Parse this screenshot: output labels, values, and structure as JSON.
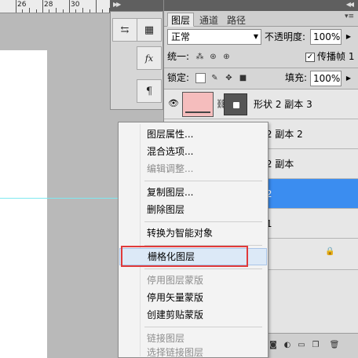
{
  "ruler": {
    "labels": [
      "26",
      "28",
      "30"
    ]
  },
  "panel_tabs": [
    "图层",
    "通道",
    "路径"
  ],
  "blend_mode": "正常",
  "opacity_label": "不透明度:",
  "opacity_value": "100%",
  "unify_label": "统一:",
  "propagate_label": "传播帧 1",
  "propagate_checked": "✓",
  "lock_label": "锁定:",
  "fill_label": "填充:",
  "fill_value": "100%",
  "layers": [
    {
      "name": "形状 2 副本 3",
      "visible": true,
      "selected": false
    },
    {
      "name": "状 2 副本 2",
      "visible": false,
      "selected": false
    },
    {
      "name": "状 2 副本",
      "visible": false,
      "selected": false
    },
    {
      "name": "状 2",
      "visible": false,
      "selected": true
    },
    {
      "name": "状 1",
      "visible": false,
      "selected": false
    }
  ],
  "context_menu": {
    "items": [
      {
        "label": "图层属性...",
        "disabled": false
      },
      {
        "label": "混合选项...",
        "disabled": false
      },
      {
        "label": "编辑调整...",
        "disabled": true
      },
      {
        "label": "复制图层...",
        "disabled": false
      },
      {
        "label": "删除图层",
        "disabled": false
      },
      {
        "label": "转换为智能对象",
        "disabled": false
      },
      {
        "label": "栅格化图层",
        "disabled": false
      },
      {
        "label": "停用图层蒙版",
        "disabled": true
      },
      {
        "label": "停用矢量蒙版",
        "disabled": false
      },
      {
        "label": "创建剪贴蒙版",
        "disabled": false
      },
      {
        "label": "链接图层",
        "disabled": true
      },
      {
        "label": "选择链接图层",
        "disabled": true
      }
    ]
  },
  "dock_icons": [
    "history-icon",
    "swatches-icon",
    "styles-fx-icon",
    "paragraph-icon"
  ],
  "colors": {
    "selection": "#3b8df0",
    "thumb": "#f5bdbd",
    "highlight_box": "#e03a3a",
    "guide": "#7fe9f0"
  }
}
